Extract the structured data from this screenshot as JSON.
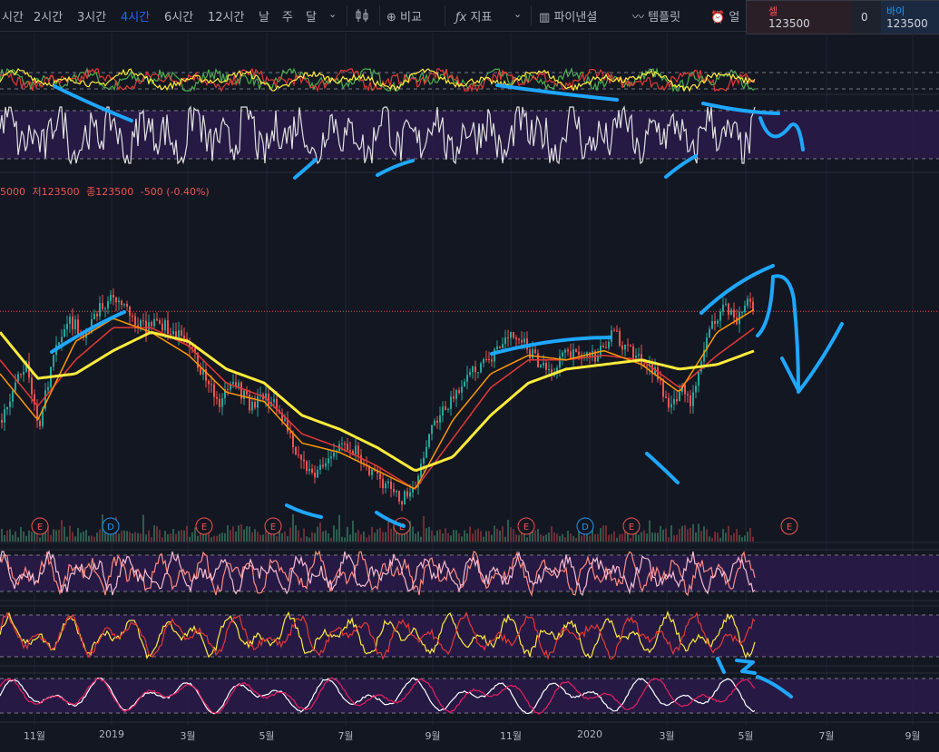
{
  "toolbar": {
    "intervals": [
      "시간",
      "2시간",
      "3시간",
      "4시간",
      "6시간",
      "12시간",
      "날",
      "주",
      "달"
    ],
    "active_interval": "4시간",
    "compare_label": "비교",
    "indicators_label": "지표",
    "financials_label": "파이낸셜",
    "templates_label": "템플릿",
    "alert_label": "얼"
  },
  "trade": {
    "sell_label": "셀",
    "sell_price": "123500",
    "quantity": "0",
    "buy_label": "바이",
    "buy_price": "123500"
  },
  "ohlc_info": {
    "open_fragment": "5000",
    "low": "저123500",
    "close": "종123500",
    "change": "-500 (-0.40%)"
  },
  "colors": {
    "background": "#131722",
    "grid": "#1e2330",
    "up": "#26a69a",
    "down": "#ef5350",
    "ma_yellow": "#ffeb3b",
    "ma_orange": "#ff9800",
    "ma_red": "#e53935",
    "panel_fill": "#2a1b4a",
    "annotation": "#1ea7ff",
    "accent": "#2962ff"
  },
  "chart_data": {
    "type": "line",
    "price_series": [
      {
        "t": 0,
        "v": 100000
      },
      {
        "t": 0.02,
        "v": 108000
      },
      {
        "t": 0.035,
        "v": 112000
      },
      {
        "t": 0.05,
        "v": 97000
      },
      {
        "t": 0.07,
        "v": 115000
      },
      {
        "t": 0.09,
        "v": 122000
      },
      {
        "t": 0.11,
        "v": 118000
      },
      {
        "t": 0.13,
        "v": 124000
      },
      {
        "t": 0.15,
        "v": 127000
      },
      {
        "t": 0.17,
        "v": 123000
      },
      {
        "t": 0.19,
        "v": 120000
      },
      {
        "t": 0.21,
        "v": 121000
      },
      {
        "t": 0.23,
        "v": 119000
      },
      {
        "t": 0.25,
        "v": 117000
      },
      {
        "t": 0.27,
        "v": 109000
      },
      {
        "t": 0.29,
        "v": 104000
      },
      {
        "t": 0.31,
        "v": 108000
      },
      {
        "t": 0.33,
        "v": 103000
      },
      {
        "t": 0.35,
        "v": 105000
      },
      {
        "t": 0.37,
        "v": 102000
      },
      {
        "t": 0.39,
        "v": 93000
      },
      {
        "t": 0.41,
        "v": 88000
      },
      {
        "t": 0.43,
        "v": 90000
      },
      {
        "t": 0.45,
        "v": 96000
      },
      {
        "t": 0.47,
        "v": 93000
      },
      {
        "t": 0.49,
        "v": 88000
      },
      {
        "t": 0.51,
        "v": 86000
      },
      {
        "t": 0.53,
        "v": 82000
      },
      {
        "t": 0.55,
        "v": 87000
      },
      {
        "t": 0.57,
        "v": 98000
      },
      {
        "t": 0.59,
        "v": 103000
      },
      {
        "t": 0.61,
        "v": 108000
      },
      {
        "t": 0.63,
        "v": 111000
      },
      {
        "t": 0.65,
        "v": 114000
      },
      {
        "t": 0.67,
        "v": 119000
      },
      {
        "t": 0.69,
        "v": 117000
      },
      {
        "t": 0.71,
        "v": 113000
      },
      {
        "t": 0.73,
        "v": 111000
      },
      {
        "t": 0.75,
        "v": 115000
      },
      {
        "t": 0.77,
        "v": 113000
      },
      {
        "t": 0.79,
        "v": 114000
      },
      {
        "t": 0.81,
        "v": 119000
      },
      {
        "t": 0.83,
        "v": 115000
      },
      {
        "t": 0.85,
        "v": 113000
      },
      {
        "t": 0.87,
        "v": 110000
      },
      {
        "t": 0.885,
        "v": 102000
      },
      {
        "t": 0.9,
        "v": 107000
      },
      {
        "t": 0.915,
        "v": 104000
      },
      {
        "t": 0.93,
        "v": 115000
      },
      {
        "t": 0.945,
        "v": 121000
      },
      {
        "t": 0.96,
        "v": 125000
      },
      {
        "t": 0.975,
        "v": 122000
      },
      {
        "t": 0.99,
        "v": 127000
      },
      {
        "t": 1.0,
        "v": 123500
      }
    ],
    "ma_yellow": [
      {
        "t": 0,
        "v": 119000
      },
      {
        "t": 0.05,
        "v": 109000
      },
      {
        "t": 0.1,
        "v": 110000
      },
      {
        "t": 0.15,
        "v": 115000
      },
      {
        "t": 0.2,
        "v": 119000
      },
      {
        "t": 0.25,
        "v": 117000
      },
      {
        "t": 0.3,
        "v": 111000
      },
      {
        "t": 0.35,
        "v": 108000
      },
      {
        "t": 0.4,
        "v": 101000
      },
      {
        "t": 0.45,
        "v": 98000
      },
      {
        "t": 0.5,
        "v": 94000
      },
      {
        "t": 0.55,
        "v": 89000
      },
      {
        "t": 0.6,
        "v": 92000
      },
      {
        "t": 0.65,
        "v": 101000
      },
      {
        "t": 0.7,
        "v": 108000
      },
      {
        "t": 0.75,
        "v": 111000
      },
      {
        "t": 0.8,
        "v": 112000
      },
      {
        "t": 0.85,
        "v": 113000
      },
      {
        "t": 0.9,
        "v": 111000
      },
      {
        "t": 0.95,
        "v": 112000
      },
      {
        "t": 1.0,
        "v": 115000
      }
    ],
    "ma_orange": [
      {
        "t": 0,
        "v": 110000
      },
      {
        "t": 0.05,
        "v": 100000
      },
      {
        "t": 0.1,
        "v": 117000
      },
      {
        "t": 0.15,
        "v": 122000
      },
      {
        "t": 0.2,
        "v": 119000
      },
      {
        "t": 0.25,
        "v": 114000
      },
      {
        "t": 0.3,
        "v": 106000
      },
      {
        "t": 0.35,
        "v": 104000
      },
      {
        "t": 0.4,
        "v": 95000
      },
      {
        "t": 0.45,
        "v": 93000
      },
      {
        "t": 0.5,
        "v": 89000
      },
      {
        "t": 0.55,
        "v": 85000
      },
      {
        "t": 0.6,
        "v": 100000
      },
      {
        "t": 0.65,
        "v": 110000
      },
      {
        "t": 0.7,
        "v": 114000
      },
      {
        "t": 0.75,
        "v": 113000
      },
      {
        "t": 0.8,
        "v": 115000
      },
      {
        "t": 0.85,
        "v": 112000
      },
      {
        "t": 0.9,
        "v": 106000
      },
      {
        "t": 0.95,
        "v": 119000
      },
      {
        "t": 1.0,
        "v": 124000
      }
    ],
    "ma_red": [
      {
        "t": 0,
        "v": 113000
      },
      {
        "t": 0.05,
        "v": 103000
      },
      {
        "t": 0.1,
        "v": 113000
      },
      {
        "t": 0.15,
        "v": 120000
      },
      {
        "t": 0.2,
        "v": 120000
      },
      {
        "t": 0.25,
        "v": 116000
      },
      {
        "t": 0.3,
        "v": 108000
      },
      {
        "t": 0.35,
        "v": 105000
      },
      {
        "t": 0.4,
        "v": 97000
      },
      {
        "t": 0.45,
        "v": 94000
      },
      {
        "t": 0.5,
        "v": 90000
      },
      {
        "t": 0.55,
        "v": 85000
      },
      {
        "t": 0.6,
        "v": 96000
      },
      {
        "t": 0.65,
        "v": 107000
      },
      {
        "t": 0.7,
        "v": 113000
      },
      {
        "t": 0.75,
        "v": 113000
      },
      {
        "t": 0.8,
        "v": 114000
      },
      {
        "t": 0.85,
        "v": 113000
      },
      {
        "t": 0.9,
        "v": 107000
      },
      {
        "t": 0.95,
        "v": 114000
      },
      {
        "t": 1.0,
        "v": 120000
      }
    ],
    "last_price": 123500,
    "y_range": [
      78000,
      132000
    ],
    "x_tick_labels": [
      "11월",
      "2019",
      "3월",
      "5월",
      "7월",
      "9월",
      "11월",
      "2020",
      "3월",
      "5월",
      "7월",
      "9월"
    ],
    "event_markers": [
      {
        "label": "E",
        "kind": "earnings"
      },
      {
        "label": "D",
        "kind": "dividend"
      },
      {
        "label": "E",
        "kind": "earnings"
      },
      {
        "label": "E",
        "kind": "earnings"
      },
      {
        "label": "E",
        "kind": "earnings"
      },
      {
        "label": "E",
        "kind": "earnings"
      },
      {
        "label": "D",
        "kind": "dividend"
      },
      {
        "label": "E",
        "kind": "earnings"
      },
      {
        "label": "E",
        "kind": "earnings"
      }
    ],
    "grid": true
  }
}
